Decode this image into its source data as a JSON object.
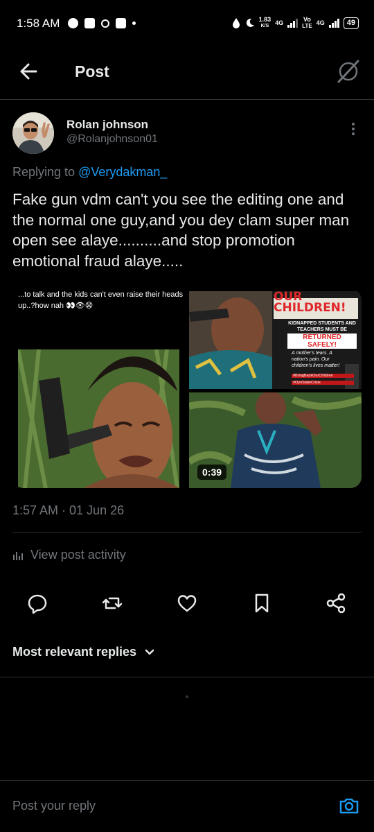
{
  "status_bar": {
    "time": "1:58 AM",
    "speed_value": "1.83",
    "speed_unit": "K/S",
    "net1": "4G",
    "net2_top": "Vo",
    "net2_bottom": "LTE",
    "net3": "4G",
    "battery": "49"
  },
  "header": {
    "title": "Post",
    "back_icon": "arrow-left-icon",
    "grok_icon": "grok-icon"
  },
  "post": {
    "author_name": "Rolan johnson",
    "author_handle": "@Rolanjohnson01",
    "replying_prefix": "Replying to ",
    "replying_to": "@Verydakman_",
    "text": "Fake gun vdm can't you see the editing one and the normal one guy,and you dey clam super man open see alaye..........and stop promotion emotional fraud alaye.....",
    "media": {
      "left_caption": "...to talk and the kids can't even raise their heads up..?how nah 👀👁😧",
      "top_right_headline": "OUR CHILDREN!",
      "top_right_sub1": "KIDNAPPED STUDENTS AND TEACHERS MUST BE",
      "top_right_sub2": "RETURNED SAFELY!",
      "top_right_quote": "A mother's tears. A nation's pain. Our children's lives matter!",
      "top_right_tag1": "#BringBackOurChildren",
      "top_right_tag2": "#OyoStateCrisis",
      "video_duration": "0:39"
    },
    "timestamp": "1:57 AM · 01 Jun 26",
    "activity_label": "View post activity"
  },
  "actions": {
    "reply_icon": "reply-icon",
    "repost_icon": "repost-icon",
    "like_icon": "heart-icon",
    "bookmark_icon": "bookmark-icon",
    "share_icon": "share-icon"
  },
  "replies": {
    "sort_label": "Most relevant replies"
  },
  "reply_bar": {
    "placeholder": "Post your reply",
    "camera_icon": "camera-icon"
  },
  "colors": {
    "background": "#000000",
    "text_primary": "#e7e9ea",
    "text_secondary": "#71767b",
    "accent": "#1d9bf0",
    "divider": "#2f3336"
  }
}
